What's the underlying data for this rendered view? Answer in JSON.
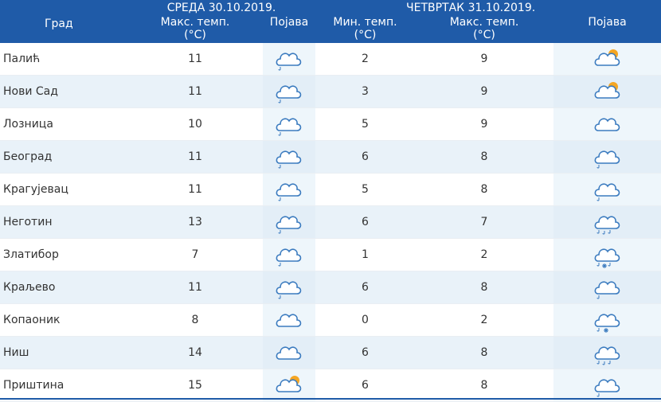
{
  "header": {
    "city_label": "Град",
    "day1": {
      "label": "СРЕДА  30.10.2019.",
      "max_label": "Макс. темп.",
      "max_unit": "(°C)",
      "phenomenon_label": "Појава"
    },
    "day2": {
      "label": "ЧЕТВРТАК  31.10.2019.",
      "min_label": "Мин. темп.",
      "min_unit": "(°C)",
      "max_label": "Макс. темп.",
      "max_unit": "(°C)",
      "phenomenon_label": "Појава"
    }
  },
  "colors": {
    "header_bg": "#1f5ba8",
    "icon_stroke": "#3b7bbf",
    "sun": "#f5a623"
  },
  "rows": [
    {
      "city": "Палић",
      "max1": "11",
      "icon1": "cloud-drizzle-icon",
      "min2": "2",
      "max2": "9",
      "icon2": "partly-cloudy-icon"
    },
    {
      "city": "Нови Сад",
      "max1": "11",
      "icon1": "cloud-drizzle-icon",
      "min2": "3",
      "max2": "9",
      "icon2": "partly-cloudy-icon"
    },
    {
      "city": "Лозница",
      "max1": "10",
      "icon1": "cloud-drizzle-icon",
      "min2": "5",
      "max2": "9",
      "icon2": "cloud-icon"
    },
    {
      "city": "Београд",
      "max1": "11",
      "icon1": "cloud-drizzle-icon",
      "min2": "6",
      "max2": "8",
      "icon2": "cloud-drizzle-icon"
    },
    {
      "city": "Крагујевац",
      "max1": "11",
      "icon1": "cloud-drizzle-icon",
      "min2": "5",
      "max2": "8",
      "icon2": "cloud-drizzle-icon"
    },
    {
      "city": "Неготин",
      "max1": "13",
      "icon1": "cloud-drizzle-icon",
      "min2": "6",
      "max2": "7",
      "icon2": "cloud-rain-icon"
    },
    {
      "city": "Златибор",
      "max1": "7",
      "icon1": "cloud-drizzle-icon",
      "min2": "1",
      "max2": "2",
      "icon2": "cloud-rain-snow-icon"
    },
    {
      "city": "Краљево",
      "max1": "11",
      "icon1": "cloud-drizzle-icon",
      "min2": "6",
      "max2": "8",
      "icon2": "cloud-drizzle-icon"
    },
    {
      "city": "Копаоник",
      "max1": "8",
      "icon1": "cloud-icon",
      "min2": "0",
      "max2": "2",
      "icon2": "cloud-drizzle-snow-icon"
    },
    {
      "city": "Ниш",
      "max1": "14",
      "icon1": "cloud-icon",
      "min2": "6",
      "max2": "8",
      "icon2": "cloud-rain-icon"
    },
    {
      "city": "Приштина",
      "max1": "15",
      "icon1": "partly-cloudy-icon",
      "min2": "6",
      "max2": "8",
      "icon2": "cloud-drizzle-icon"
    }
  ]
}
